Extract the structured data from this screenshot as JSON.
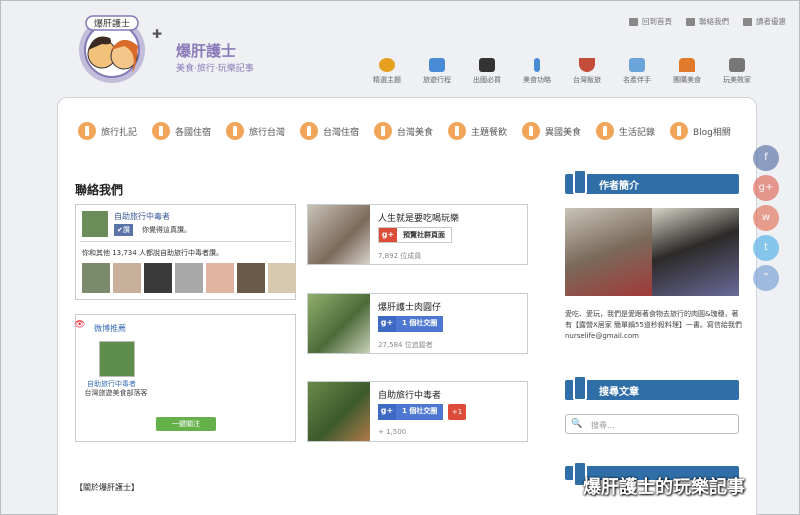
{
  "header": {
    "logo_text": "爆肝護士",
    "site_title": "爆肝護士",
    "subtitle": "美食‧旅行‧玩樂記事",
    "top_links": [
      {
        "label": "回到首頁",
        "icon": "home-icon"
      },
      {
        "label": "聯絡我們",
        "icon": "mail-icon"
      },
      {
        "label": "讀者優惠",
        "icon": "gift-icon"
      }
    ],
    "nav": [
      {
        "label": "精選主題",
        "icon": "medal-icon",
        "color": "#e5a020"
      },
      {
        "label": "旅遊行程",
        "icon": "map-icon",
        "color": "#4a8bd6"
      },
      {
        "label": "出國必買",
        "icon": "bag-icon",
        "color": "#333333"
      },
      {
        "label": "美食功略",
        "icon": "fork-knife-icon",
        "color": "#4a8bd6"
      },
      {
        "label": "台灣飯旅",
        "icon": "rice-icon",
        "color": "#c44d3a"
      },
      {
        "label": "名產伴手",
        "icon": "gift-box-icon",
        "color": "#6aa4d8"
      },
      {
        "label": "團購美食",
        "icon": "cake-icon",
        "color": "#e07a2a"
      },
      {
        "label": "玩美敗家",
        "icon": "cart-icon",
        "color": "#777777"
      }
    ]
  },
  "categories": [
    "旅行扎記",
    "各國住宿",
    "旅行台灣",
    "台灣住宿",
    "台灣美食",
    "主題餐飲",
    "異國美食",
    "生活記錄",
    "Blog相關"
  ],
  "contact": {
    "heading": "聯絡我們",
    "facebook": {
      "page_name": "自助旅行中毒者",
      "like_label": "✔讚",
      "like_text": "你覺得這真讚。",
      "count_text": "你和其他 13,734 人都說自助旅行中毒者讚。"
    },
    "weibo": {
      "title": "微博推薦",
      "name": "自助旅行中毒者",
      "desc": "台灣旅遊美食部落客",
      "button": "一鍵關注"
    }
  },
  "gplus": [
    {
      "name": "人生就是要吃喝玩樂",
      "button": "預覽社群頁面",
      "count": "7,892 位成員",
      "style": "white"
    },
    {
      "name": "爆肝護士肉圓仔",
      "button": "1 個社交圈",
      "count": "27,584 位追蹤者",
      "style": "blue"
    },
    {
      "name": "自助旅行中毒者",
      "button": "1 個社交圈",
      "count": "+ 1,500",
      "style": "blue",
      "plus_one": "+1"
    }
  ],
  "about_heading": "【關於爆肝護士】",
  "sidebar": {
    "author_heading": "作者簡介",
    "author_text": "愛吃、愛玩，我們是愛跟著食物去旅行的肉圓&瑰穗，著有【露營X居家 簡單鍋55道秒殺料理】一書。寫信給我們 nurselife@gmail.com",
    "search_heading": "搜尋文章",
    "search_placeholder": "搜尋..."
  },
  "watermark": "爆肝護士的玩樂記事"
}
